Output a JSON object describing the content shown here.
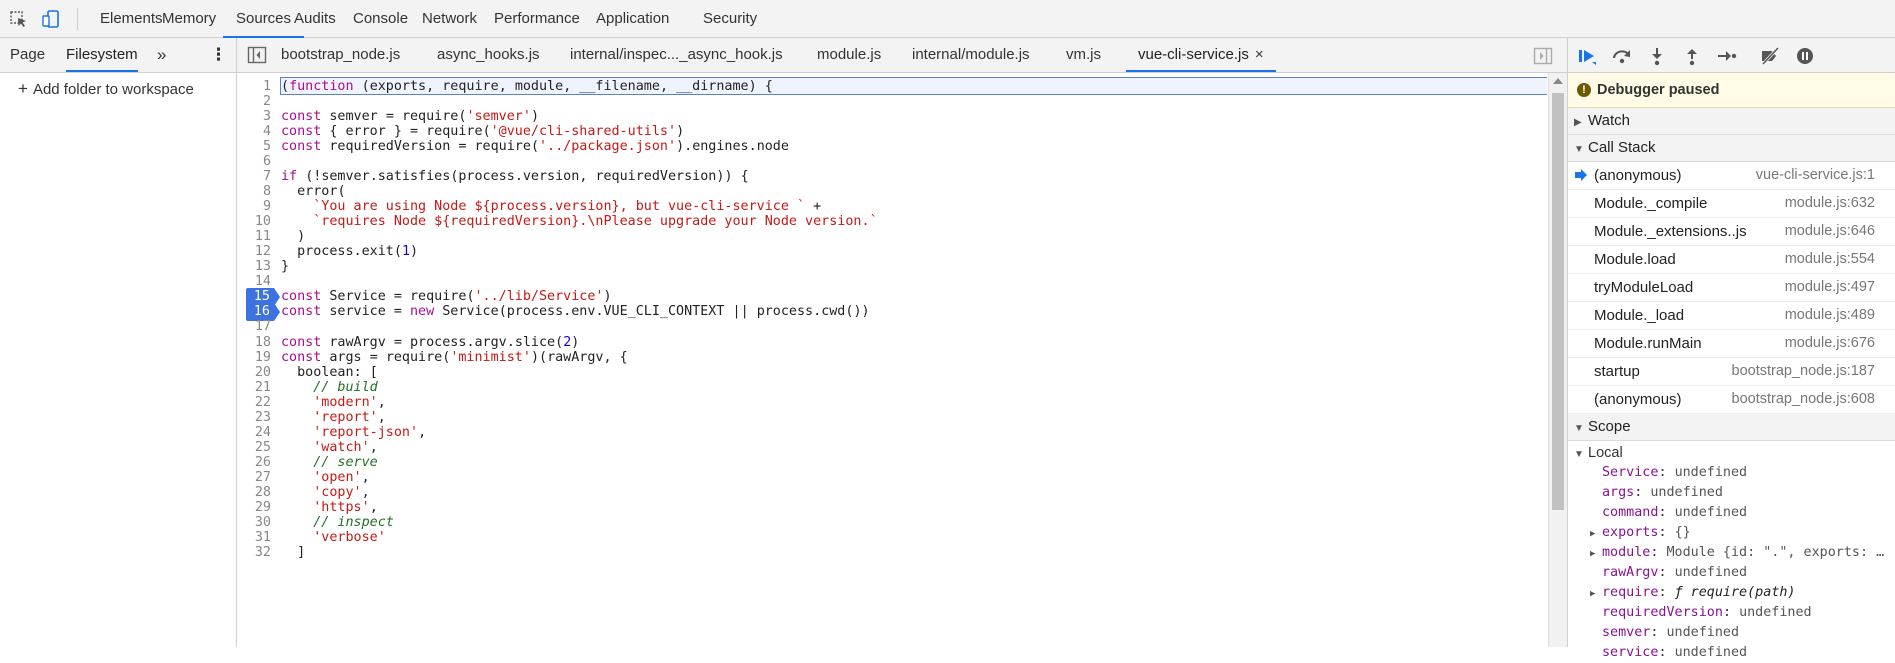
{
  "topbar": {
    "inspect_icon": "cursor-select-icon",
    "device_icon": "device-toolbar-icon",
    "tabs": [
      "Elements",
      "Memory",
      "Sources",
      "Audits",
      "Console",
      "Network",
      "Performance",
      "Application",
      "Security"
    ],
    "active_tab": "Sources"
  },
  "navigator": {
    "tabs": [
      "Page",
      "Filesystem"
    ],
    "active_tab": "Filesystem",
    "more": "»",
    "menu": "⋮",
    "add_folder": "Add folder to workspace"
  },
  "editor": {
    "tabs": [
      "bootstrap_node.js",
      "async_hooks.js",
      "internal/inspec..._async_hook.js",
      "module.js",
      "internal/module.js",
      "vm.js",
      "vue-cli-service.js"
    ],
    "active_tab": "vue-cli-service.js",
    "close": "×",
    "lines": [
      {
        "n": "1",
        "t": "(function (exports, require, module, __filename, __dirname) {"
      },
      {
        "n": "2",
        "t": ""
      },
      {
        "n": "3",
        "t": "const semver = require('semver')"
      },
      {
        "n": "4",
        "t": "const { error } = require('@vue/cli-shared-utils')"
      },
      {
        "n": "5",
        "t": "const requiredVersion = require('../package.json').engines.node"
      },
      {
        "n": "6",
        "t": ""
      },
      {
        "n": "7",
        "t": "if (!semver.satisfies(process.version, requiredVersion)) {"
      },
      {
        "n": "8",
        "t": "  error("
      },
      {
        "n": "9",
        "t": "    `You are using Node ${process.version}, but vue-cli-service ` +"
      },
      {
        "n": "10",
        "t": "    `requires Node ${requiredVersion}.\\nPlease upgrade your Node version.`"
      },
      {
        "n": "11",
        "t": "  )"
      },
      {
        "n": "12",
        "t": "  process.exit(1)"
      },
      {
        "n": "13",
        "t": "}"
      },
      {
        "n": "14",
        "t": ""
      },
      {
        "n": "15",
        "t": "const Service = require('../lib/Service')"
      },
      {
        "n": "16",
        "t": "const service = new Service(process.env.VUE_CLI_CONTEXT || process.cwd())"
      },
      {
        "n": "17",
        "t": ""
      },
      {
        "n": "18",
        "t": "const rawArgv = process.argv.slice(2)"
      },
      {
        "n": "19",
        "t": "const args = require('minimist')(rawArgv, {"
      },
      {
        "n": "20",
        "t": "  boolean: ["
      },
      {
        "n": "21",
        "t": "    // build"
      },
      {
        "n": "22",
        "t": "    'modern',"
      },
      {
        "n": "23",
        "t": "    'report',"
      },
      {
        "n": "24",
        "t": "    'report-json',"
      },
      {
        "n": "25",
        "t": "    'watch',"
      },
      {
        "n": "26",
        "t": "    // serve"
      },
      {
        "n": "27",
        "t": "    'open',"
      },
      {
        "n": "28",
        "t": "    'copy',"
      },
      {
        "n": "29",
        "t": "    'https',"
      },
      {
        "n": "30",
        "t": "    // inspect"
      },
      {
        "n": "31",
        "t": "    'verbose'"
      },
      {
        "n": "32",
        "t": "  ]"
      }
    ],
    "breakpoints": [
      "15",
      "16"
    ]
  },
  "debugger": {
    "buttons": [
      "resume-icon",
      "step-over-icon",
      "step-into-icon",
      "step-out-icon",
      "step-icon",
      "deactivate-breakpoints-icon",
      "pause-on-exceptions-icon"
    ],
    "paused_label": "Debugger paused",
    "watch_label": "Watch",
    "callstack_label": "Call Stack",
    "frames": [
      {
        "fn": "(anonymous)",
        "loc": "vue-cli-service.js:1"
      },
      {
        "fn": "Module._compile",
        "loc": "module.js:632"
      },
      {
        "fn": "Module._extensions..js",
        "loc": "module.js:646"
      },
      {
        "fn": "Module.load",
        "loc": "module.js:554"
      },
      {
        "fn": "tryModuleLoad",
        "loc": "module.js:497"
      },
      {
        "fn": "Module._load",
        "loc": "module.js:489"
      },
      {
        "fn": "Module.runMain",
        "loc": "module.js:676"
      },
      {
        "fn": "startup",
        "loc": "bootstrap_node.js:187"
      },
      {
        "fn": "(anonymous)",
        "loc": "bootstrap_node.js:608"
      }
    ],
    "scope_label": "Scope",
    "local_label": "Local",
    "scope_vars": [
      {
        "name": "Service",
        "value": "undefined",
        "expandable": false
      },
      {
        "name": "args",
        "value": "undefined",
        "expandable": false
      },
      {
        "name": "command",
        "value": "undefined",
        "expandable": false
      },
      {
        "name": "exports",
        "value": "{}",
        "expandable": true
      },
      {
        "name": "module",
        "value": "Module {id: \".\", exports: …",
        "expandable": true
      },
      {
        "name": "rawArgv",
        "value": "undefined",
        "expandable": false
      },
      {
        "name": "require",
        "value": "ƒ require(path)",
        "expandable": true
      },
      {
        "name": "requiredVersion",
        "value": "undefined",
        "expandable": false
      },
      {
        "name": "semver",
        "value": "undefined",
        "expandable": false
      },
      {
        "name": "service",
        "value": "undefined",
        "expandable": false
      }
    ]
  }
}
